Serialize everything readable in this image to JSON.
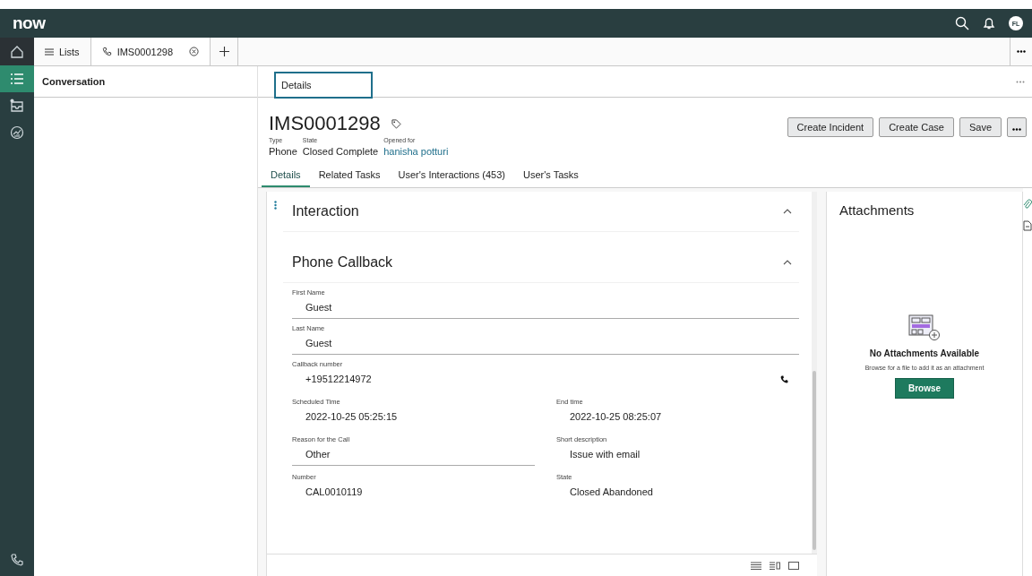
{
  "top_bar": {
    "logo": "now",
    "avatar": "FL"
  },
  "workspace_tabs": [
    {
      "label": "Lists",
      "kind": "list",
      "selected": false
    },
    {
      "label": "IMS0001298",
      "kind": "record",
      "selected": true
    }
  ],
  "rail": [
    {
      "kind": "list",
      "selected": true
    },
    {
      "kind": "inbox",
      "selected": false
    },
    {
      "kind": "analytics",
      "selected": false
    }
  ],
  "conversation": {
    "title": "Conversation"
  },
  "subtabs": [
    {
      "label": "Details",
      "selected": true
    }
  ],
  "record": {
    "number": "IMS0001298",
    "meta": [
      {
        "label": "Type",
        "value": "Phone",
        "link": false
      },
      {
        "label": "State",
        "value": "Closed Complete",
        "link": false
      },
      {
        "label": "Opened for",
        "value": "hanisha potturi",
        "link": true
      }
    ],
    "actions": [
      "Create Incident",
      "Create Case",
      "Save"
    ]
  },
  "record_tabs": [
    {
      "label": "Details",
      "selected": true
    },
    {
      "label": "Related Tasks",
      "selected": false
    },
    {
      "label": "User's Interactions (453)",
      "selected": false
    },
    {
      "label": "User's Tasks",
      "selected": false
    }
  ],
  "sections": [
    {
      "title": "Interaction",
      "expanded": true
    },
    {
      "title": "Phone Callback",
      "expanded": true,
      "fields": [
        {
          "label": "First Name",
          "value": "Guest",
          "kind": "full",
          "editable": true
        },
        {
          "label": "Last Name",
          "value": "Guest",
          "kind": "full",
          "editable": true
        },
        {
          "label": "Callback number",
          "value": "+19512214972",
          "kind": "phone",
          "editable": false
        },
        {
          "label": "Scheduled Time",
          "value": "2022-10-25 05:25:15",
          "kind": "half",
          "editable": false
        },
        {
          "label": "End time",
          "value": "2022-10-25 08:25:07",
          "kind": "half",
          "editable": false
        },
        {
          "label": "Reason for the Call",
          "value": "Other",
          "kind": "half",
          "editable": true
        },
        {
          "label": "Short description",
          "value": "Issue with email",
          "kind": "half",
          "editable": false
        },
        {
          "label": "Number",
          "value": "CAL0010119",
          "kind": "half",
          "editable": false
        },
        {
          "label": "State",
          "value": "Closed Abandoned",
          "kind": "half",
          "editable": false
        }
      ]
    }
  ],
  "attachments": {
    "title": "Attachments",
    "empty_title": "No Attachments Available",
    "empty_text": "Browse for a file to add it as an attachment",
    "button": "Browse"
  }
}
